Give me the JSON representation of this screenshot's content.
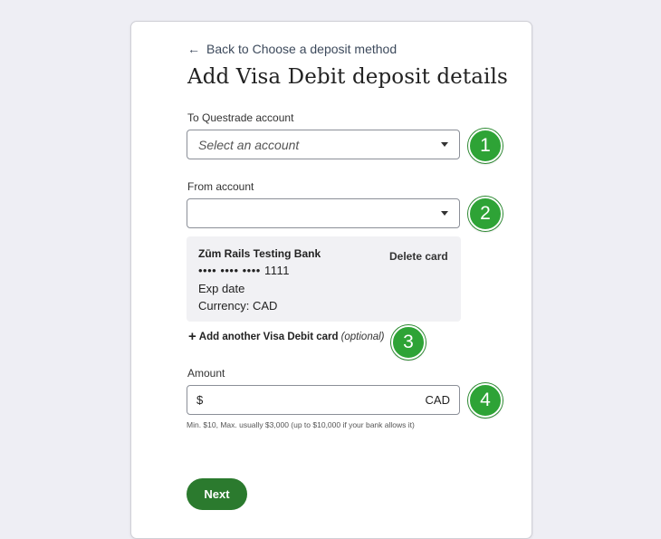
{
  "header": {
    "back_link": "Back to Choose a deposit method",
    "title": "Add Visa Debit deposit details"
  },
  "to_account": {
    "label": "To Questrade account",
    "placeholder": "Select an account"
  },
  "from_account": {
    "label": "From account",
    "value": ""
  },
  "saved_card": {
    "bank_name": "Zūm Rails Testing Bank",
    "masked_number": "•••• •••• •••• 1111",
    "exp_date": "Exp date",
    "currency": "Currency: CAD",
    "delete_label": "Delete card"
  },
  "add_card": {
    "label": "Add another Visa Debit card",
    "optional": "(optional)"
  },
  "amount": {
    "label": "Amount",
    "currency_symbol": "$",
    "currency_code": "CAD",
    "value": "",
    "hint": "Min. $10, Max. usually $3,000 (up to $10,000 if your bank allows it)"
  },
  "next_label": "Next",
  "steps": [
    "1",
    "2",
    "3",
    "4"
  ],
  "colors": {
    "badge_green": "#2ea336",
    "button_green": "#2b7a2e"
  }
}
